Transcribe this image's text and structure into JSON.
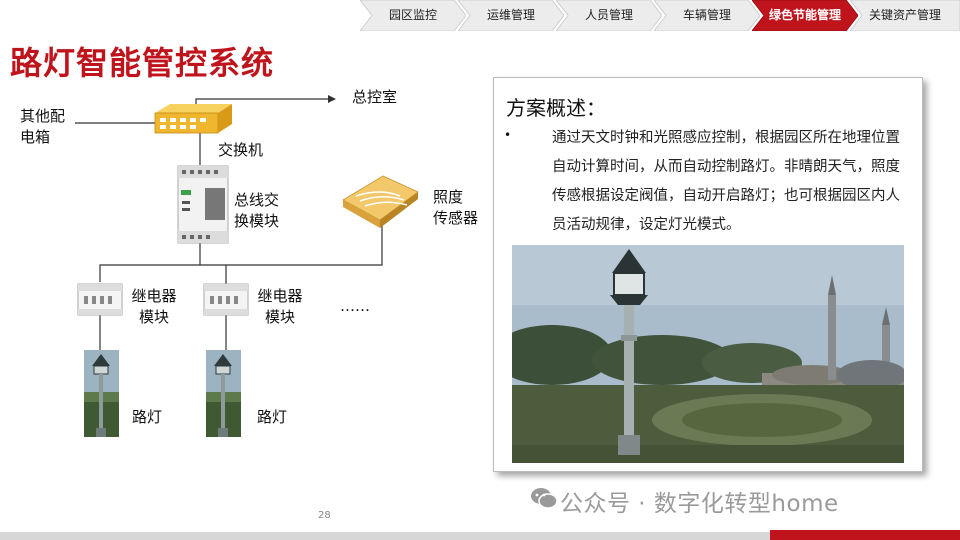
{
  "nav": {
    "tabs": [
      {
        "label": "园区监控",
        "active": false
      },
      {
        "label": "运维管理",
        "active": false
      },
      {
        "label": "人员管理",
        "active": false
      },
      {
        "label": "车辆管理",
        "active": false
      },
      {
        "label": "绿色节能管理",
        "active": true
      },
      {
        "label": "关键资产管理",
        "active": false
      }
    ],
    "active_color": "#c0141c"
  },
  "title": "路灯智能管控系统",
  "diagram": {
    "other_box_label": "其他配\n电箱",
    "control_room_label": "总控室",
    "switch_label": "交换机",
    "bus_module_label": "总线交\n换模块",
    "sensor_label": "照度\n传感器",
    "relay_label_1": "继电器\n模块",
    "relay_label_2": "继电器\n模块",
    "ellipsis": "……",
    "lamp_label_1": "路灯",
    "lamp_label_2": "路灯"
  },
  "panel": {
    "title": "方案概述：",
    "bullet": "•",
    "description": "通过天文时钟和光照感应控制，根据园区所在地理位置自动计算时间，从而自动控制路灯。非晴朗天气，照度传感根据设定阀值，自动开启路灯；也可根据园区内人员活动规律，设定灯光模式。"
  },
  "page_number": "28",
  "watermark": "公众号 · 数字化转型home"
}
